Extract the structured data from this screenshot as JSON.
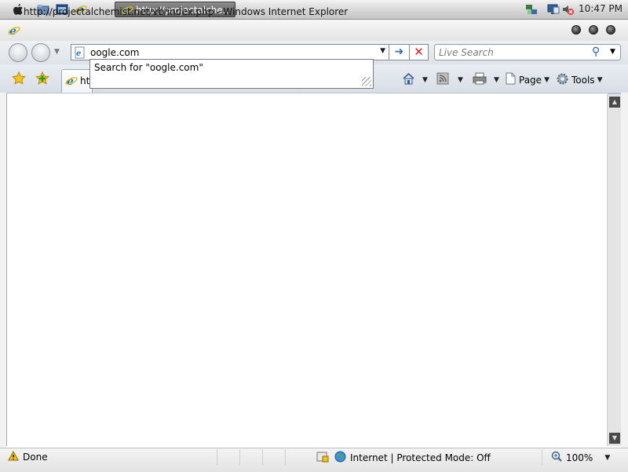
{
  "taskbar": {
    "task_button_label": "http://projectalche...",
    "clock": "10:47 PM"
  },
  "window": {
    "title": "http://projectalchemist.net/vb/index.php - Windows Internet Explorer"
  },
  "address_bar": {
    "value": "oogle.com",
    "autocomplete_suggestion": "Search for \"oogle.com\""
  },
  "search_box": {
    "placeholder": "Live Search"
  },
  "tab": {
    "label": "htt"
  },
  "command_bar": {
    "page_label": "Page",
    "tools_label": "Tools"
  },
  "status_bar": {
    "status": "Done",
    "zone": "Internet | Protected Mode: Off",
    "zoom": "100%"
  },
  "colors": {
    "accent": "#2a6fb8",
    "stop": "#d22222",
    "taskbar_active": "#5b5b5b"
  }
}
